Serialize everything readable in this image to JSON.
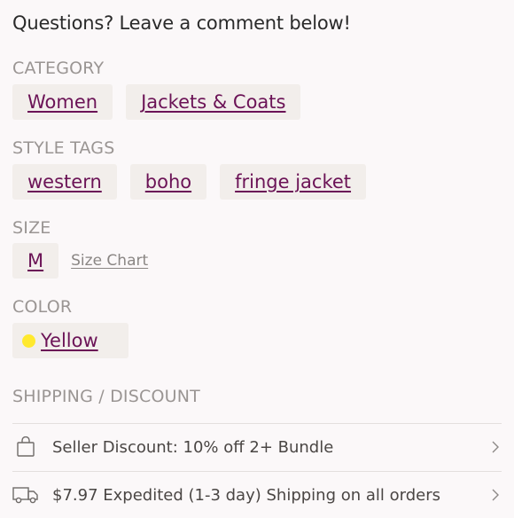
{
  "intro_text": "Questions? Leave a comment below!",
  "category": {
    "label": "CATEGORY",
    "items": [
      "Women",
      "Jackets & Coats"
    ]
  },
  "style_tags": {
    "label": "STYLE TAGS",
    "items": [
      "western",
      "boho",
      "fringe jacket"
    ]
  },
  "size": {
    "label": "SIZE",
    "value": "M",
    "chart_link": "Size Chart"
  },
  "color": {
    "label": "COLOR",
    "value": "Yellow",
    "swatch": "#ffe92e"
  },
  "shipping": {
    "label": "SHIPPING / DISCOUNT",
    "rows": [
      {
        "icon": "shopping-bag-icon",
        "text": "Seller Discount: 10% off 2+ Bundle"
      },
      {
        "icon": "delivery-truck-icon",
        "text": "$7.97 Expedited (1-3 day) Shipping on all orders"
      }
    ]
  },
  "colors": {
    "link": "#6b1356",
    "label": "#9a9593",
    "chip_bg": "#f2eeeb",
    "background": "#fbf8f9"
  }
}
